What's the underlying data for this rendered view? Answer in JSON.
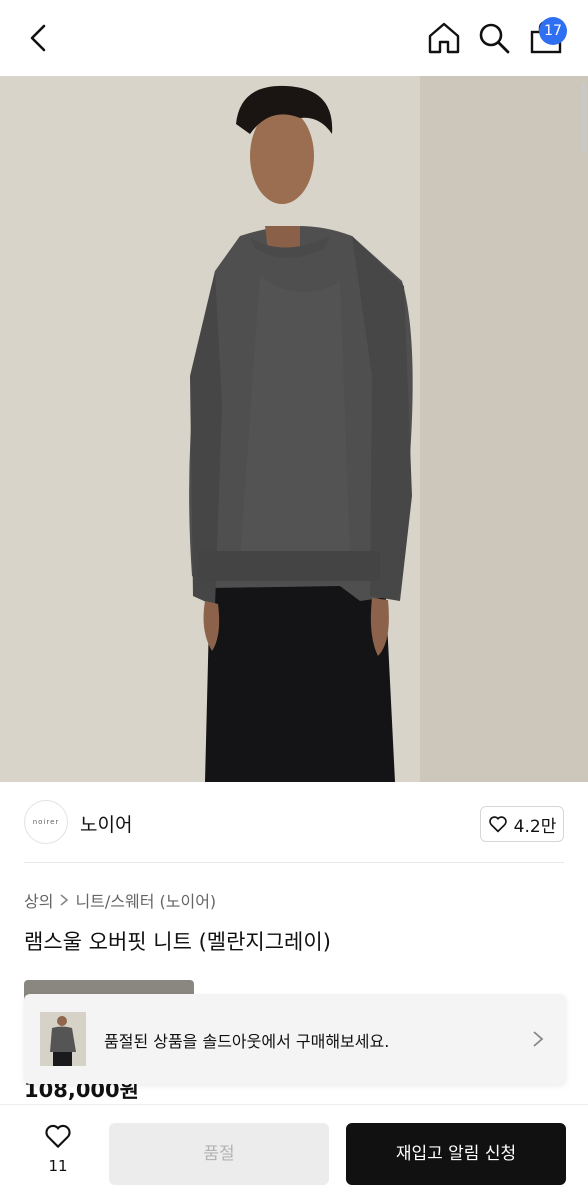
{
  "header": {
    "back_icon": "chevron-left-icon",
    "home_icon": "home-icon",
    "search_icon": "search-icon",
    "bag_icon": "shopping-bag-icon",
    "bag_count": "17",
    "badge_color": "#2f6ff2"
  },
  "product": {
    "image_alt_icon": "product-photo",
    "brand_logo_text": "noirer",
    "brand_name": "노이어",
    "likes": "4.2만",
    "breadcrumb": [
      "상의",
      "니트/스웨터 (노이어)"
    ],
    "title": "램스울 오버핏 니트 (멜란지그레이)",
    "price": "108,000원"
  },
  "toast": {
    "message": "품절된 상품을 솔드아웃에서 구매해보세요."
  },
  "bottom": {
    "wish_count": "11",
    "soldout_label": "품절",
    "restock_label": "재입고 알림 신청"
  }
}
